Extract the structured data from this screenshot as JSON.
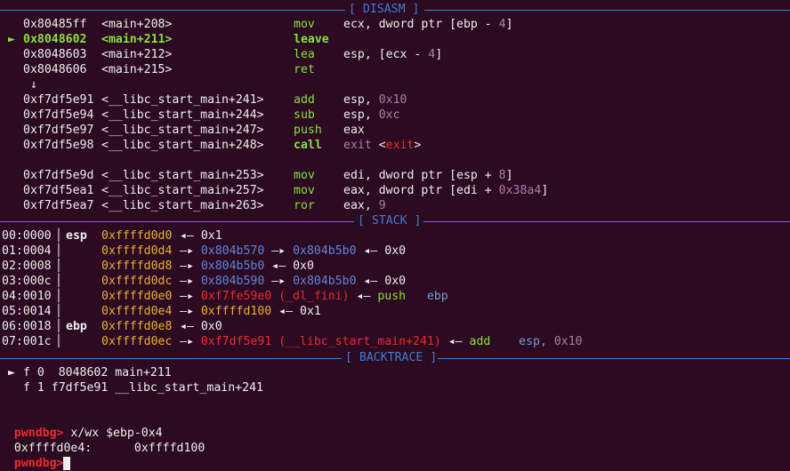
{
  "sections": {
    "disasm": "[ DISASM ]",
    "stack": "[ STACK ]",
    "backtrace": "[ BACKTRACE ]"
  },
  "disasm": [
    {
      "addr": "0x80485ff",
      "sym": "<main+208>",
      "mn": "mov",
      "ops": [
        [
          "ecx, dword ptr [ebp - ",
          "w"
        ],
        [
          "4",
          "p"
        ],
        [
          "]",
          "w"
        ]
      ],
      "current": false
    },
    {
      "addr": "0x8048602",
      "sym": "<main+211>",
      "mn": "leave",
      "ops": [],
      "current": true
    },
    {
      "addr": "0x8048603",
      "sym": "<main+212>",
      "mn": "lea",
      "ops": [
        [
          "esp, [ecx - ",
          "w"
        ],
        [
          "4",
          "p"
        ],
        [
          "]",
          "w"
        ]
      ],
      "current": false
    },
    {
      "addr": "0x8048606",
      "sym": "<main+215>",
      "mn": "ret",
      "ops": [],
      "current": false
    },
    {
      "arrow": "↓"
    },
    {
      "addr": "0xf7df5e91",
      "sym": "<__libc_start_main+241>",
      "mn": "add",
      "ops": [
        [
          "esp, ",
          "w"
        ],
        [
          "0x10",
          "p"
        ]
      ]
    },
    {
      "addr": "0xf7df5e94",
      "sym": "<__libc_start_main+244>",
      "mn": "sub",
      "ops": [
        [
          "esp, ",
          "w"
        ],
        [
          "0xc",
          "p"
        ]
      ]
    },
    {
      "addr": "0xf7df5e97",
      "sym": "<__libc_start_main+247>",
      "mn": "push",
      "ops": [
        [
          "eax",
          "w"
        ]
      ]
    },
    {
      "addr": "0xf7df5e98",
      "sym": "<__libc_start_main+248>",
      "mn": "call",
      "bold": true,
      "ops": [
        [
          "exit ",
          "p"
        ],
        [
          "<",
          "w"
        ],
        [
          "exit",
          "r"
        ],
        [
          ">",
          "w"
        ]
      ]
    },
    {
      "blank": true
    },
    {
      "addr": "0xf7df5e9d",
      "sym": "<__libc_start_main+253>",
      "mn": "mov",
      "ops": [
        [
          "edi, dword ptr [esp + ",
          "w"
        ],
        [
          "8",
          "p"
        ],
        [
          "]",
          "w"
        ]
      ]
    },
    {
      "addr": "0xf7df5ea1",
      "sym": "<__libc_start_main+257>",
      "mn": "mov",
      "ops": [
        [
          "eax, dword ptr [edi + ",
          "w"
        ],
        [
          "0x38a4",
          "p"
        ],
        [
          "]",
          "w"
        ]
      ]
    },
    {
      "addr": "0xf7df5ea7",
      "sym": "<__libc_start_main+263>",
      "mn": "ror",
      "ops": [
        [
          "eax, ",
          "w"
        ],
        [
          "9",
          "p"
        ]
      ]
    }
  ],
  "stack": [
    {
      "idx": "00:0000",
      "reg": "esp",
      "addr": "0xffffd0d0",
      "chain": [
        [
          "◂— ",
          "w"
        ],
        [
          "0x1",
          "w"
        ]
      ]
    },
    {
      "idx": "01:0004",
      "reg": "",
      "addr": "0xffffd0d4",
      "chain": [
        [
          "—▸ ",
          "w"
        ],
        [
          "0x804b570",
          "b"
        ],
        [
          " —▸ ",
          "w"
        ],
        [
          "0x804b5b0",
          "b"
        ],
        [
          " ◂— ",
          "w"
        ],
        [
          "0x0",
          "w"
        ]
      ]
    },
    {
      "idx": "02:0008",
      "reg": "",
      "addr": "0xffffd0d8",
      "chain": [
        [
          "—▸ ",
          "w"
        ],
        [
          "0x804b5b0",
          "b"
        ],
        [
          " ◂— ",
          "w"
        ],
        [
          "0x0",
          "w"
        ]
      ]
    },
    {
      "idx": "03:000c",
      "reg": "",
      "addr": "0xffffd0dc",
      "chain": [
        [
          "—▸ ",
          "w"
        ],
        [
          "0x804b590",
          "b"
        ],
        [
          " —▸ ",
          "w"
        ],
        [
          "0x804b5b0",
          "b"
        ],
        [
          " ◂— ",
          "w"
        ],
        [
          "0x0",
          "w"
        ]
      ]
    },
    {
      "idx": "04:0010",
      "reg": "",
      "addr": "0xffffd0e0",
      "chain": [
        [
          "—▸ ",
          "w"
        ],
        [
          "0xf7fe59e0 (_dl_fini)",
          "r"
        ],
        [
          " ◂— ",
          "w"
        ],
        [
          "push",
          "g"
        ],
        [
          "   ebp",
          "lb"
        ]
      ]
    },
    {
      "idx": "05:0014",
      "reg": "",
      "addr": "0xffffd0e4",
      "chain": [
        [
          "—▸ ",
          "w"
        ],
        [
          "0xffffd100",
          "y"
        ],
        [
          " ◂— ",
          "w"
        ],
        [
          "0x1",
          "w"
        ]
      ]
    },
    {
      "idx": "06:0018",
      "reg": "ebp",
      "addr": "0xffffd0e8",
      "chain": [
        [
          "◂— ",
          "w"
        ],
        [
          "0x0",
          "w"
        ]
      ]
    },
    {
      "idx": "07:001c",
      "reg": "",
      "addr": "0xffffd0ec",
      "chain": [
        [
          "—▸ ",
          "w"
        ],
        [
          "0xf7df5e91 (__libc_start_main+241)",
          "r"
        ],
        [
          " ◂— ",
          "w"
        ],
        [
          "add",
          "g"
        ],
        [
          "    esp, ",
          "lb"
        ],
        [
          "0x10",
          "p"
        ]
      ]
    }
  ],
  "backtrace": [
    {
      "marker": "►",
      "text": "f 0  8048602 main+211"
    },
    {
      "marker": "",
      "text": "f 1 f7df5e91 __libc_start_main+241"
    }
  ],
  "console": {
    "prompt": "pwndbg>",
    "command": " x/wx $ebp-0x4",
    "output_addr": "0xffffd0e4:",
    "output_val": "0xffffd100",
    "prompt2": "pwndbg>"
  },
  "colors": {
    "bg": "#2b0a22",
    "rule": "#3d7fcf",
    "addr": "#c4a000",
    "code": "#5f87d7",
    "green": "#8ae234",
    "red": "#ef2929",
    "purple": "#ad7fa8"
  }
}
